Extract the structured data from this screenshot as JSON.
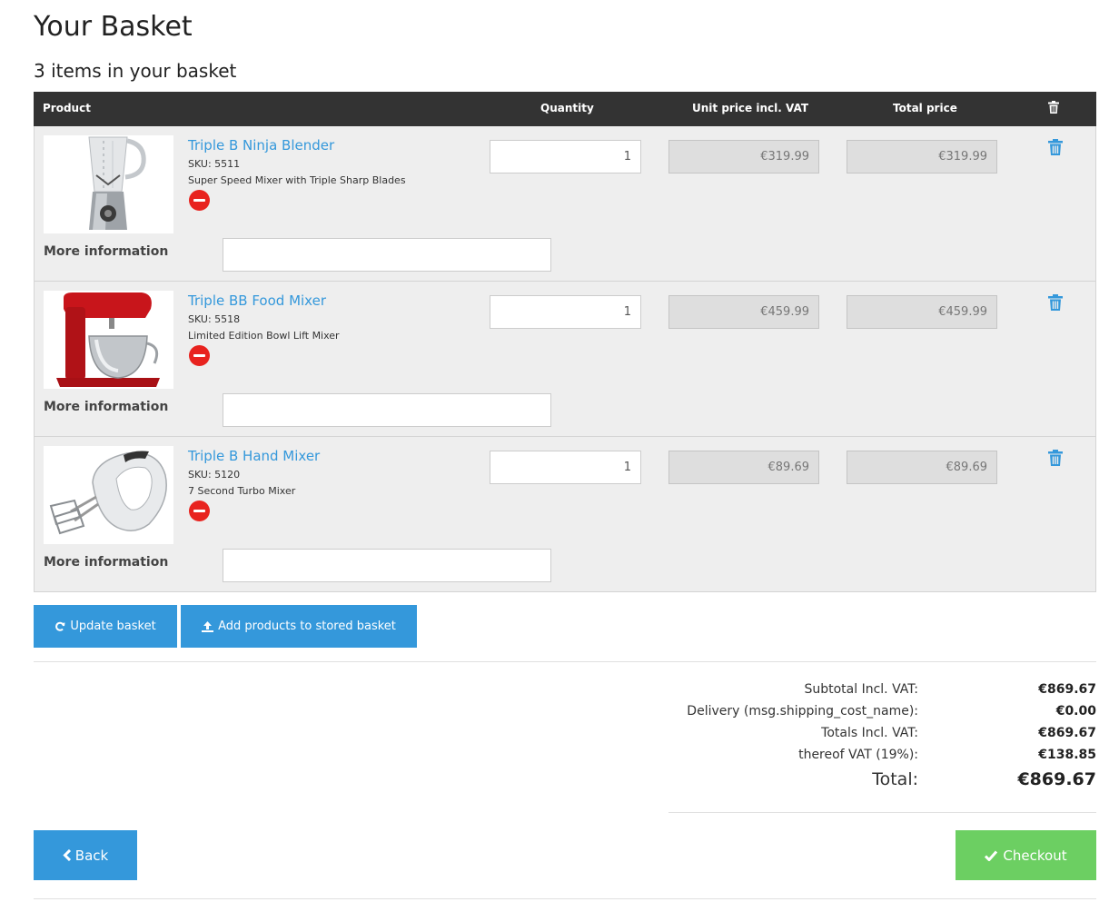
{
  "page": {
    "title": "Your Basket",
    "items_count": "3 items in your basket"
  },
  "table": {
    "headers": {
      "product": "Product",
      "quantity": "Quantity",
      "unit_price": "Unit price incl. VAT",
      "total_price": "Total price"
    },
    "more_info_label": "More information",
    "rows": [
      {
        "name": "Triple B Ninja Blender",
        "sku": "SKU: 5511",
        "description": "Super Speed Mixer with Triple Sharp Blades",
        "quantity": "1",
        "unit_price": "€319.99",
        "total_price": "€319.99",
        "image": "blender-image"
      },
      {
        "name": "Triple BB Food Mixer",
        "sku": "SKU: 5518",
        "description": "Limited Edition Bowl Lift Mixer",
        "quantity": "1",
        "unit_price": "€459.99",
        "total_price": "€459.99",
        "image": "stand-mixer-image"
      },
      {
        "name": "Triple B Hand Mixer",
        "sku": "SKU: 5120",
        "description": "7 Second Turbo Mixer",
        "quantity": "1",
        "unit_price": "€89.69",
        "total_price": "€89.69",
        "image": "hand-mixer-image"
      }
    ]
  },
  "actions": {
    "update_label": "Update basket",
    "store_label": "Add products to stored basket",
    "back_label": "Back",
    "checkout_label": "Checkout"
  },
  "totals": {
    "subtotal_label": "Subtotal Incl. VAT:",
    "subtotal_value": "€869.67",
    "delivery_label": "Delivery (msg.shipping_cost_name):",
    "delivery_value": "€0.00",
    "totals_label": "Totals Incl. VAT:",
    "totals_value": "€869.67",
    "vat_label": "thereof VAT (19%):",
    "vat_value": "€138.85",
    "grand_label": "Total:",
    "grand_value": "€869.67"
  },
  "colors": {
    "accent": "#3498db",
    "header_bg": "#333333",
    "row_bg": "#eeeeee",
    "remove": "#e8231f",
    "checkout": "#6ccf62"
  }
}
